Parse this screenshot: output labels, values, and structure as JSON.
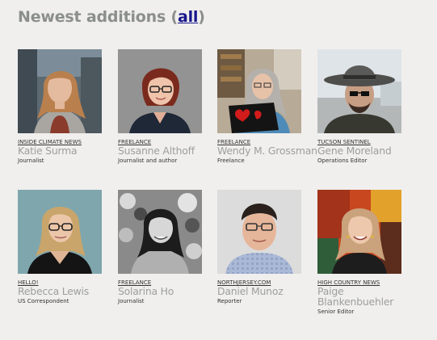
{
  "section": {
    "title_prefix": "Newest additions (",
    "title_link": "all",
    "title_suffix": ")"
  },
  "people": [
    {
      "outlet": "INSIDE CLIMATE NEWS",
      "name": "Katie Surma",
      "role": "Journalist"
    },
    {
      "outlet": "FREELANCE",
      "name": "Susanne Althoff",
      "role": "Journalist and author"
    },
    {
      "outlet": "FREELANCE",
      "name": "Wendy M. Grossman",
      "role": "Freelance"
    },
    {
      "outlet": "TUCSON SENTINEL",
      "name": "Gene Moreland",
      "role": "Operations Editor"
    },
    {
      "outlet": "HELLO!",
      "name": "Rebecca Lewis",
      "role": "US Correspondent"
    },
    {
      "outlet": "FREELANCE",
      "name": "Solarina Ho",
      "role": "Journalist"
    },
    {
      "outlet": "NORTHJERSEY.COM",
      "name": "Daniel Munoz",
      "role": "Reporter"
    },
    {
      "outlet": "HIGH COUNTRY NEWS",
      "name": "Paige Blankenbuehler",
      "role": "Senior Editor"
    }
  ]
}
